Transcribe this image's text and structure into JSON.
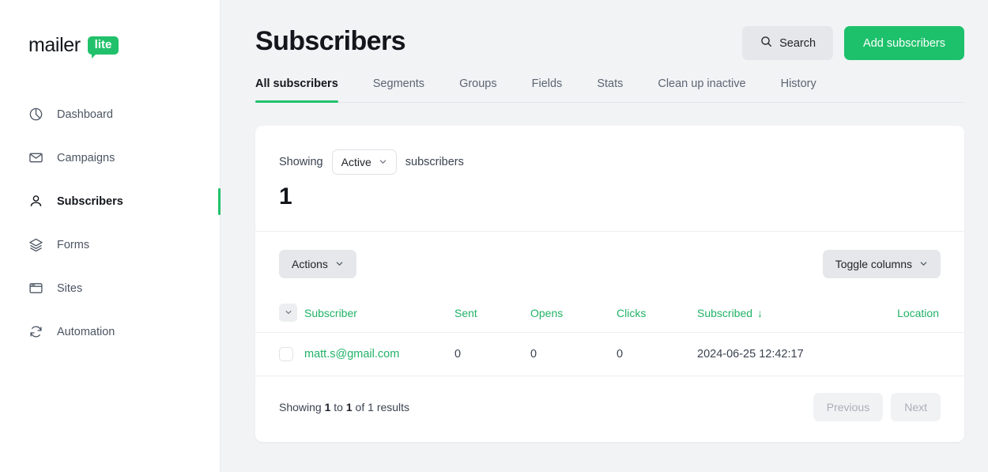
{
  "brand": {
    "word": "mailer",
    "badge": "lite"
  },
  "colors": {
    "green": "#21c16b",
    "link_green": "#21b266",
    "page_bg": "#f2f3f5",
    "card_bg": "#ffffff"
  },
  "sidebar": {
    "items": [
      {
        "label": "Dashboard",
        "icon": "pie-chart-icon",
        "active": false
      },
      {
        "label": "Campaigns",
        "icon": "envelope-icon",
        "active": false
      },
      {
        "label": "Subscribers",
        "icon": "user-icon",
        "active": true
      },
      {
        "label": "Forms",
        "icon": "layers-icon",
        "active": false
      },
      {
        "label": "Sites",
        "icon": "window-icon",
        "active": false
      },
      {
        "label": "Automation",
        "icon": "refresh-icon",
        "active": false
      }
    ]
  },
  "header": {
    "title": "Subscribers",
    "search_label": "Search",
    "search_icon": "search-icon",
    "add_label": "Add subscribers"
  },
  "tabs": [
    {
      "label": "All subscribers",
      "active": true
    },
    {
      "label": "Segments",
      "active": false
    },
    {
      "label": "Groups",
      "active": false
    },
    {
      "label": "Fields",
      "active": false
    },
    {
      "label": "Stats",
      "active": false
    },
    {
      "label": "Clean up inactive",
      "active": false
    },
    {
      "label": "History",
      "active": false
    }
  ],
  "filter": {
    "prefix": "Showing",
    "status_value": "Active",
    "suffix": "subscribers",
    "count": "1"
  },
  "toolbar": {
    "actions_label": "Actions",
    "toggle_columns_label": "Toggle columns"
  },
  "table": {
    "columns": [
      {
        "key": "subscriber",
        "label": "Subscriber"
      },
      {
        "key": "sent",
        "label": "Sent"
      },
      {
        "key": "opens",
        "label": "Opens"
      },
      {
        "key": "clicks",
        "label": "Clicks"
      },
      {
        "key": "subscribed",
        "label": "Subscribed",
        "sorted": "desc",
        "sort_glyph": "↓"
      },
      {
        "key": "location",
        "label": "Location"
      }
    ],
    "rows": [
      {
        "subscriber": "matt.s@gmail.com",
        "sent": "0",
        "opens": "0",
        "clicks": "0",
        "subscribed": "2024-06-25 12:42:17",
        "location": ""
      }
    ]
  },
  "footer": {
    "prefix": "Showing",
    "from": "1",
    "mid": "to",
    "to": "1",
    "of": "of",
    "total": "1",
    "suffix": "results",
    "previous_label": "Previous",
    "next_label": "Next"
  }
}
